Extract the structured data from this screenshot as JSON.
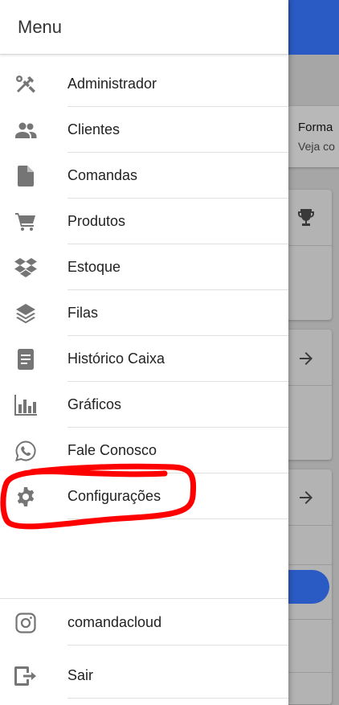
{
  "background": {
    "card_title": "Forma",
    "card_subtitle": "Veja co"
  },
  "drawer": {
    "title": "Menu",
    "items": [
      {
        "label": "Administrador",
        "icon": "tools-icon"
      },
      {
        "label": "Clientes",
        "icon": "people-icon"
      },
      {
        "label": "Comandas",
        "icon": "file-icon"
      },
      {
        "label": "Produtos",
        "icon": "cart-icon"
      },
      {
        "label": "Estoque",
        "icon": "dropbox-icon"
      },
      {
        "label": "Filas",
        "icon": "layers-icon"
      },
      {
        "label": "Histórico Caixa",
        "icon": "receipt-icon"
      },
      {
        "label": "Gráficos",
        "icon": "bar-chart-icon"
      },
      {
        "label": "Fale Conosco",
        "icon": "whatsapp-icon"
      },
      {
        "label": "Configurações",
        "icon": "gear-icon"
      }
    ],
    "footer_items": [
      {
        "label": "comandacloud",
        "icon": "instagram-icon"
      },
      {
        "label": "Sair",
        "icon": "exit-icon"
      }
    ]
  },
  "colors": {
    "primary": "#2a5bc4",
    "icon": "#757575",
    "annotation": "#ff0000"
  }
}
